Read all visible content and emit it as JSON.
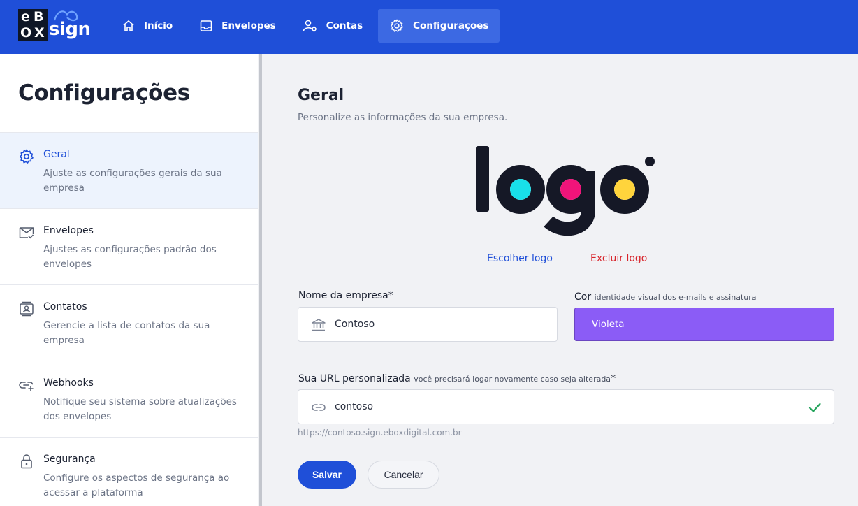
{
  "brand": {
    "name": "eBOX sign",
    "letters": [
      "e",
      "B",
      "O",
      "X"
    ],
    "word": "sign"
  },
  "nav": [
    {
      "label": "Início",
      "icon": "home-icon"
    },
    {
      "label": "Envelopes",
      "icon": "inbox-icon"
    },
    {
      "label": "Contas",
      "icon": "user-settings-icon"
    },
    {
      "label": "Configurações",
      "icon": "gear-icon",
      "active": true
    }
  ],
  "sidebar": {
    "title": "Configurações",
    "items": [
      {
        "label": "Geral",
        "desc": "Ajuste as configurações gerais da sua empresa",
        "icon": "gear-icon",
        "active": true
      },
      {
        "label": "Envelopes",
        "desc": "Ajustes as configurações padrão dos envelopes",
        "icon": "envelope-check-icon"
      },
      {
        "label": "Contatos",
        "desc": "Gerencie a lista de contatos da sua empresa",
        "icon": "contact-card-icon"
      },
      {
        "label": "Webhooks",
        "desc": "Notifique seu sistema sobre atualizações dos envelopes",
        "icon": "link-plus-icon"
      },
      {
        "label": "Segurança",
        "desc": "Configure os aspectos de segurança ao acessar a plataforma",
        "icon": "lock-icon"
      }
    ]
  },
  "main": {
    "title": "Geral",
    "subtitle": "Personalize as informações da sua empresa.",
    "logo_text": "logo",
    "choose_logo": "Escolher logo",
    "delete_logo": "Excluir logo",
    "company": {
      "label": "Nome da empresa",
      "required": "*",
      "value": "Contoso"
    },
    "color": {
      "label": "Cor",
      "hint": "identidade visual dos e-mails e assinatura",
      "value": "Violeta",
      "hex": "#8b5cf6"
    },
    "url": {
      "label": "Sua URL personalizada",
      "hint": "você precisará logar novamente caso seja alterada",
      "required": "*",
      "value": "contoso",
      "preview": "https://contoso.sign.eboxdigital.com.br"
    },
    "save": "Salvar",
    "cancel": "Cancelar"
  },
  "colors": {
    "primary": "#1f4fd8",
    "danger": "#d8232a",
    "success": "#22a35a"
  }
}
